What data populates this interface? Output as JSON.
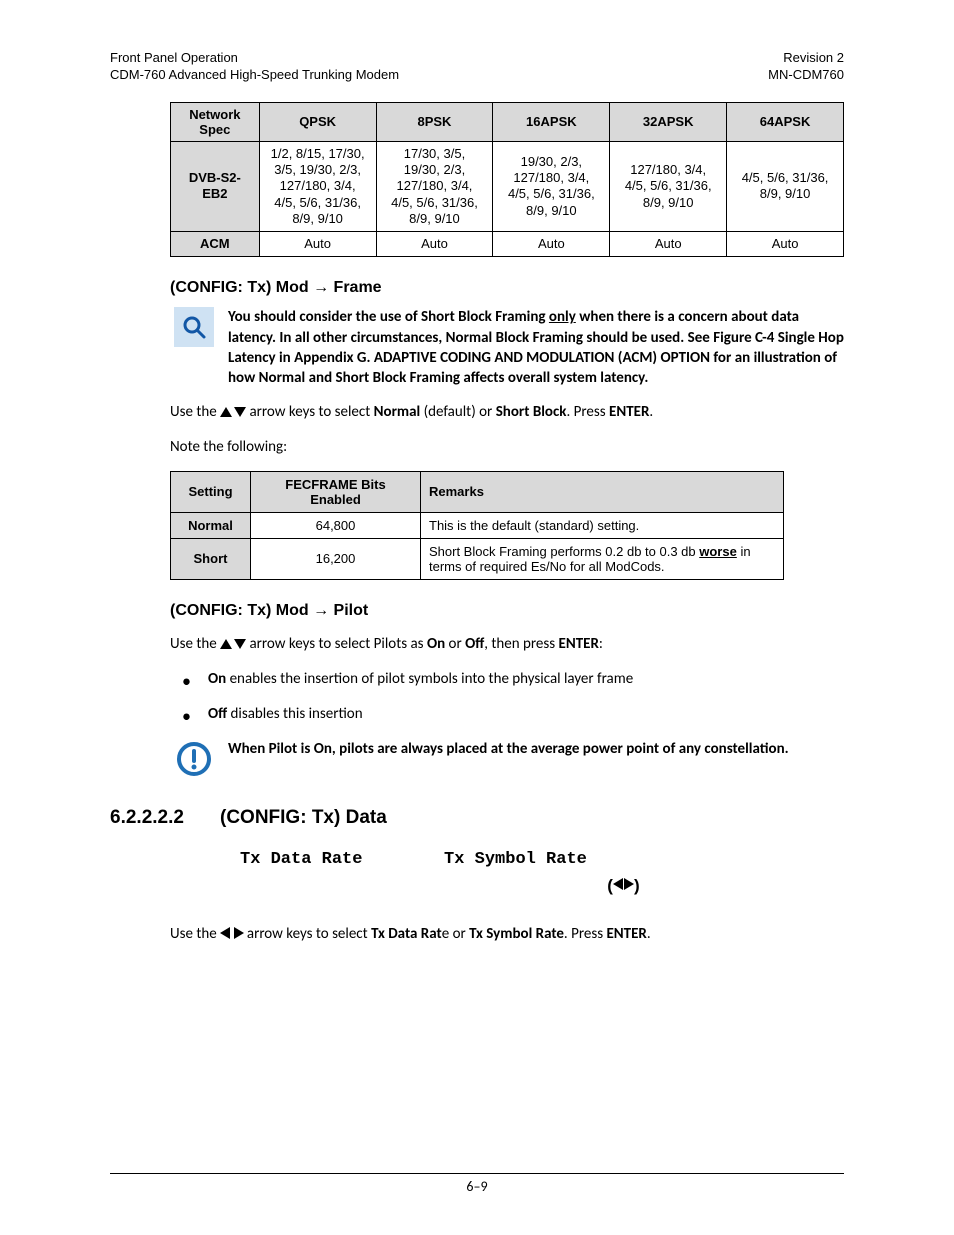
{
  "header": {
    "left1": "Front Panel Operation",
    "left2": "CDM-760 Advanced High-Speed Trunking Modem",
    "right1": "Revision 2",
    "right2": "MN-CDM760"
  },
  "modcod_table": {
    "headers": [
      "Network Spec",
      "QPSK",
      "8PSK",
      "16APSK",
      "32APSK",
      "64APSK"
    ],
    "rows": [
      {
        "spec": "DVB-S2-EB2",
        "cells": [
          "1/2, 8/15, 17/30, 3/5, 19/30, 2/3, 127/180, 3/4, 4/5, 5/6, 31/36, 8/9, 9/10",
          "17/30, 3/5, 19/30, 2/3, 127/180, 3/4, 4/5, 5/6, 31/36, 8/9, 9/10",
          "19/30, 2/3, 127/180, 3/4, 4/5, 5/6, 31/36, 8/9, 9/10",
          "127/180, 3/4, 4/5, 5/6, 31/36, 8/9, 9/10",
          "4/5, 5/6, 31/36, 8/9, 9/10"
        ]
      },
      {
        "spec": "ACM",
        "cells": [
          "Auto",
          "Auto",
          "Auto",
          "Auto",
          "Auto"
        ]
      }
    ]
  },
  "frame": {
    "heading_pre": "(CONFIG: Tx) Mod ",
    "heading_post": " Frame",
    "note": {
      "p1a": "You should consider the use of Short Block Framing ",
      "only": "only",
      "p1b": " when there is a concern about data latency. In all other circumstances, Normal Block Framing should be used. See Figure C-4 Single Hop Latency in Appendix G. ADAPTIVE CODING AND MODULATION (ACM) OPTION for an illustration of how Normal and Short Block Framing affects overall system latency."
    },
    "use_a": "Use the ",
    "use_b": " arrow keys to select ",
    "normal": "Normal",
    "default": " (default) or ",
    "short": "Short Block",
    "press": ". Press ",
    "enter": "ENTER",
    "dot": ".",
    "notefollow": "Note the following:"
  },
  "settings_table": {
    "headers": [
      "Setting",
      "FECFRAME Bits Enabled",
      "Remarks"
    ],
    "rows": [
      {
        "setting": "Normal",
        "bits": "64,800",
        "remarks_a": "This is the default (standard) setting.",
        "worse": "",
        "remarks_b": ""
      },
      {
        "setting": "Short",
        "bits": "16,200",
        "remarks_a": "Short Block Framing performs 0.2 db to 0.3 db ",
        "worse": "worse",
        "remarks_b": " in terms of required Es/No for all ModCods."
      }
    ]
  },
  "pilot": {
    "heading_pre": "(CONFIG: Tx) Mod ",
    "heading_post": " Pilot",
    "use_a": "Use the ",
    "use_b": " arrow keys to select Pilots as ",
    "on": "On",
    "or": " or ",
    "off": "Off",
    "then": ", then press ",
    "enter": "ENTER",
    "colon": ":",
    "bullets": [
      {
        "lead": "On",
        "rest": " enables the insertion of pilot symbols into the physical layer frame"
      },
      {
        "lead": "Off",
        "rest": " disables this insertion"
      }
    ],
    "note": "When Pilot is On, pilots are always placed at the average power point of any constellation."
  },
  "data": {
    "num": "6.2.2.2.2",
    "title": "(CONFIG: Tx) Data",
    "lcd_line1": "Tx Data Rate        Tx Symbol Rate",
    "use_a": "Use the ",
    "use_b": " arrow keys to select ",
    "txdr": "Tx Data Rat",
    "e_or": "e or ",
    "txsr": "Tx Symbol Rate",
    "press": ". Press ",
    "enter": "ENTER",
    "dot": "."
  },
  "footer": {
    "page": "6–9"
  }
}
